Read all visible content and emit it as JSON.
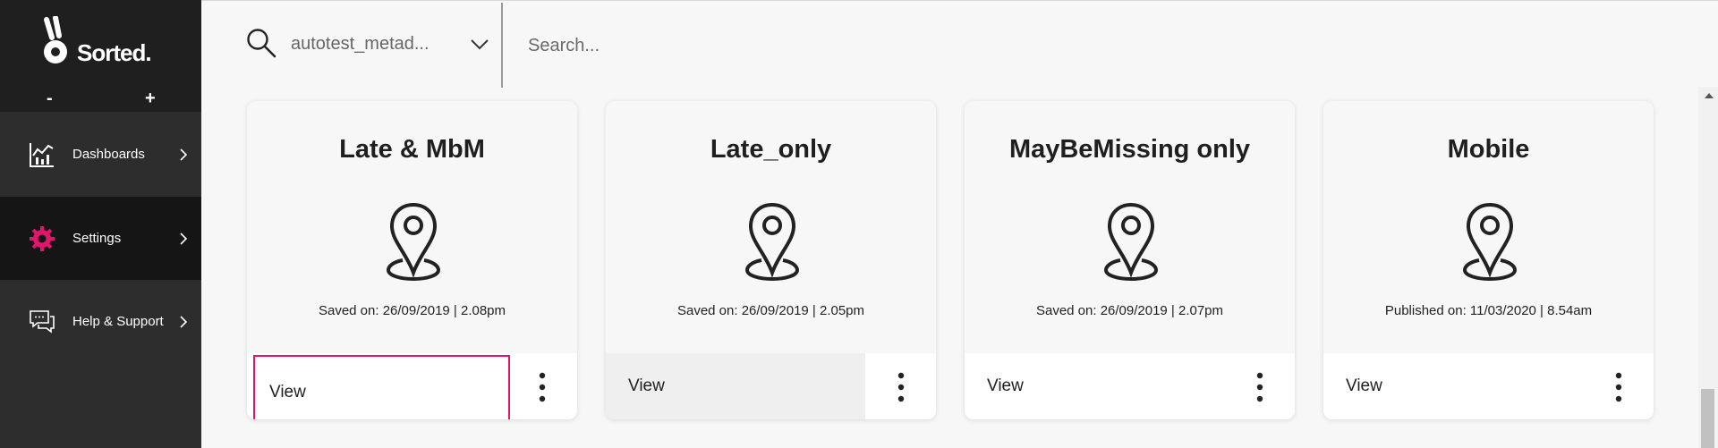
{
  "app": {
    "logo_text": "Sorted."
  },
  "zoom": {
    "minus": "-",
    "plus": "+"
  },
  "sidebar": {
    "items": [
      {
        "label": "Dashboards",
        "icon": "chart-icon"
      },
      {
        "label": "Settings",
        "icon": "gear-icon",
        "active": true,
        "icon_color": "#e3146b"
      },
      {
        "label": "Help & Support",
        "icon": "chat-icon"
      }
    ]
  },
  "topbar": {
    "org_selected": "autotest_metad...",
    "search_placeholder": "Search..."
  },
  "cards": [
    {
      "title": "Late & MbM",
      "meta": "Saved on: 26/09/2019 | 2.08pm",
      "view_label": "View",
      "icon": "location-pin-icon",
      "focused": true
    },
    {
      "title": "Late_only",
      "meta": "Saved on: 26/09/2019 | 2.05pm",
      "view_label": "View",
      "icon": "location-pin-icon",
      "hover": true
    },
    {
      "title": "MayBeMissing only",
      "meta": "Saved on: 26/09/2019 | 2.07pm",
      "view_label": "View",
      "icon": "location-pin-icon"
    },
    {
      "title": "Mobile",
      "meta": "Published on: 11/03/2020 | 8.54am",
      "view_label": "View",
      "icon": "location-pin-icon"
    }
  ],
  "colors": {
    "accent": "#e3146b",
    "sidebar_bg": "#2d2d2d",
    "sidebar_active_bg": "#151515"
  }
}
